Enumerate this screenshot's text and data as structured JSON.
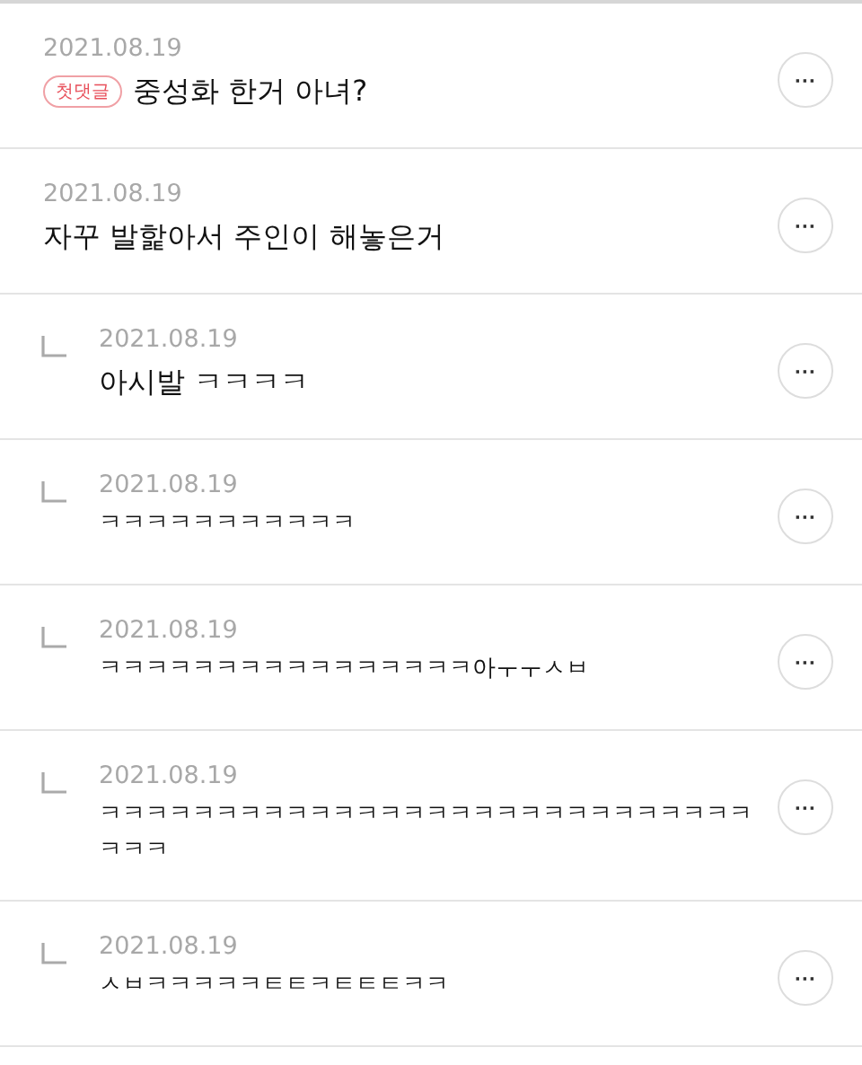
{
  "comments": [
    {
      "kind": "comment",
      "date": "2021.08.19",
      "badge": "첫댓글",
      "text": "중성화 한거 아녀?",
      "more": "···"
    },
    {
      "kind": "comment",
      "date": "2021.08.19",
      "text": "자꾸 발핥아서 주인이 해놓은거",
      "more": "···"
    },
    {
      "kind": "reply",
      "date": "2021.08.19",
      "text": "아시발 ㅋㅋㅋㅋ",
      "more": "···"
    },
    {
      "kind": "reply",
      "date": "2021.08.19",
      "text": "ㅋㅋㅋㅋㅋㅋㅋㅋㅋㅋㅋ",
      "more": "···"
    },
    {
      "kind": "reply",
      "date": "2021.08.19",
      "text": "ㅋㅋㅋㅋㅋㅋㅋㅋㅋㅋㅋㅋㅋㅋㅋㅋ아ㅜㅜㅅㅂ",
      "more": "···"
    },
    {
      "kind": "reply",
      "date": "2021.08.19",
      "text": "ㅋㅋㅋㅋㅋㅋㅋㅋㅋㅋㅋㅋㅋㅋㅋㅋㅋㅋㅋㅋㅋㅋㅋㅋㅋㅋㅋㅋㅋㅋㅋ",
      "more": "···"
    },
    {
      "kind": "reply",
      "date": "2021.08.19",
      "text": "ㅅㅂㅋㅋㅋㅋㅋㅌㅌㅋㅌㅌㅌㅋㅋ",
      "more": "···"
    }
  ]
}
